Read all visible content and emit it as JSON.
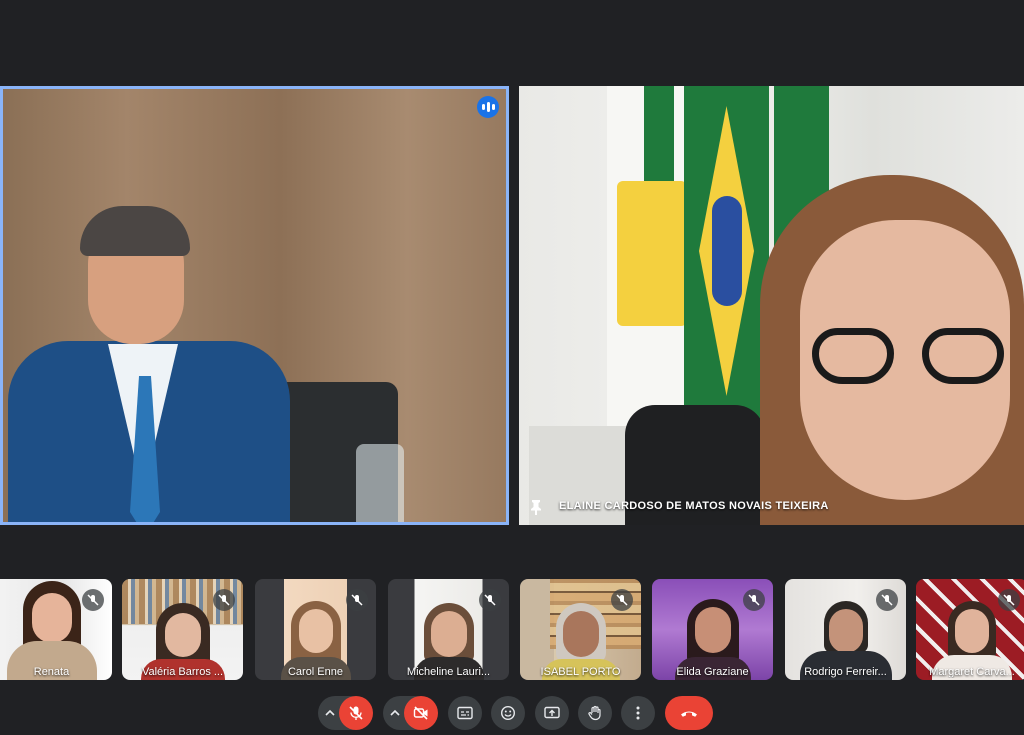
{
  "main_tiles": {
    "left": {
      "speaking": true
    },
    "right": {
      "name": "ELAINE CARDOSO DE MATOS NOVAIS TEIXEIRA",
      "pinned": true
    }
  },
  "thumbnails": [
    {
      "name": "Renata",
      "muted": true
    },
    {
      "name": "Valéria Barros ...",
      "muted": true
    },
    {
      "name": "Carol Enne",
      "muted": true
    },
    {
      "name": "Micheline Lauri...",
      "muted": true
    },
    {
      "name": "ISABEL PORTO",
      "muted": true
    },
    {
      "name": "Elida Graziane",
      "muted": true
    },
    {
      "name": "Rodrigo Ferreir...",
      "muted": true
    },
    {
      "name": "Margaret Carva...",
      "muted": true
    }
  ],
  "controls": [
    {
      "icon": "mic-off-icon",
      "state": "off",
      "color": "#ea4335"
    },
    {
      "icon": "camera-off-icon",
      "state": "off",
      "color": "#ea4335"
    },
    {
      "icon": "captions-icon"
    },
    {
      "icon": "emoji-icon"
    },
    {
      "icon": "present-screen-icon"
    },
    {
      "icon": "raise-hand-icon"
    },
    {
      "icon": "more-options-icon"
    },
    {
      "icon": "end-call-icon",
      "color": "#ea4335"
    }
  ],
  "colors": {
    "background": "#202124",
    "accent": "#8ab4f8",
    "danger": "#ea4335",
    "active_speaker": "#1a73e8"
  }
}
